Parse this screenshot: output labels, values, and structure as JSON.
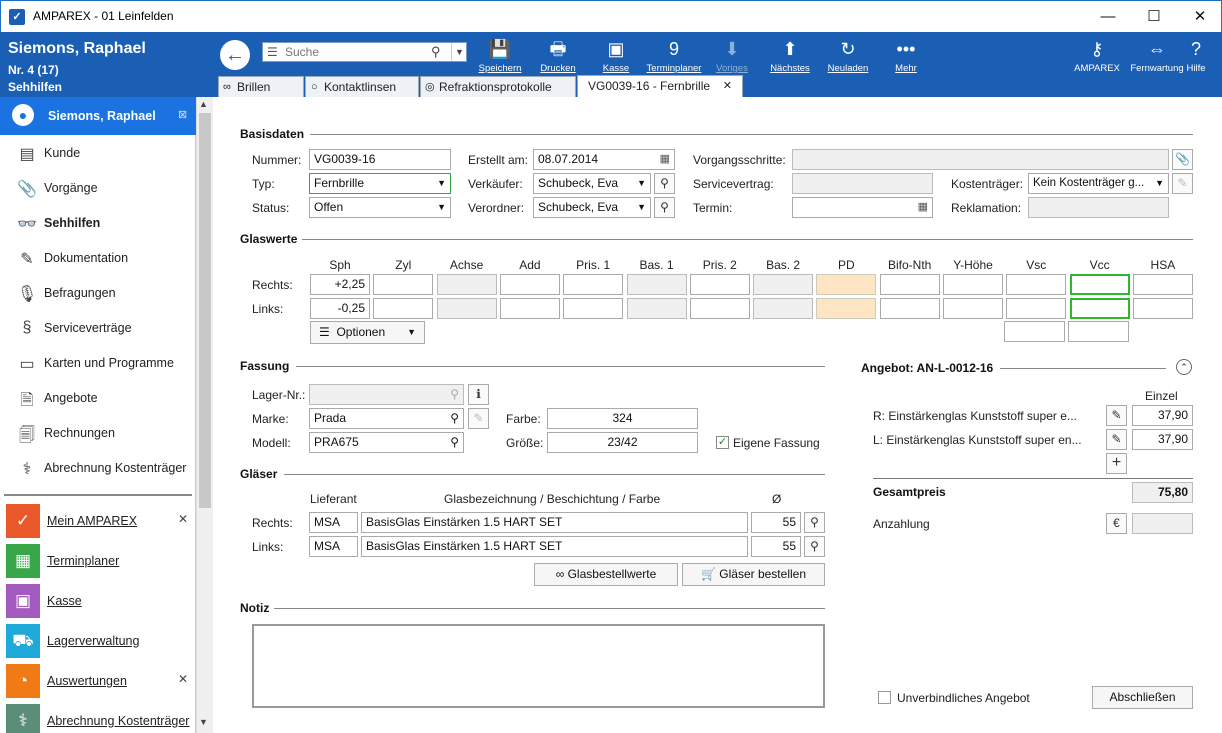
{
  "window": {
    "title": "AMPAREX - 01 Leinfelden",
    "app_icon": "✓"
  },
  "header": {
    "customer_name": "Siemons, Raphael",
    "number": "Nr. 4 (17)",
    "context": "Sehhilfen",
    "search_placeholder": "Suche",
    "toolbar": [
      {
        "label": "Speichern",
        "icon": "save-icon",
        "glyph": "💾",
        "disabled": false
      },
      {
        "label": "Drucken",
        "icon": "printer-icon",
        "glyph": "🖶",
        "disabled": false
      },
      {
        "label": "Kasse",
        "icon": "cash-register-icon",
        "glyph": "▣",
        "disabled": false
      },
      {
        "label": "Terminplaner",
        "icon": "calendar-icon",
        "glyph": "9",
        "disabled": false
      },
      {
        "label": "Voriges",
        "icon": "arrow-down-icon",
        "glyph": "⬇",
        "disabled": true
      },
      {
        "label": "Nächstes",
        "icon": "arrow-up-icon",
        "glyph": "⬆",
        "disabled": false
      },
      {
        "label": "Neuladen",
        "icon": "reload-icon",
        "glyph": "↻",
        "disabled": false
      },
      {
        "label": "Mehr",
        "icon": "more-icon",
        "glyph": "•••",
        "disabled": false
      }
    ],
    "right_toolbar": [
      {
        "label": "AMPAREX",
        "icon": "key-icon",
        "glyph": "⚷"
      },
      {
        "label": "Fernwartung",
        "icon": "remote-icon",
        "glyph": "⇔"
      },
      {
        "label": "Hilfe",
        "icon": "help-icon",
        "glyph": "?"
      }
    ]
  },
  "tabs": [
    {
      "label": "Brillen",
      "icon": "glasses-icon"
    },
    {
      "label": "Kontaktlinsen",
      "icon": "contact-lens-icon"
    },
    {
      "label": "Refraktionsprotokolle",
      "icon": "refraction-icon"
    },
    {
      "label": "VG0039-16 - Fernbrille",
      "icon": "close-icon",
      "active": true
    }
  ],
  "sidebar": {
    "active": "Siemons, Raphael",
    "items": [
      {
        "label": "Kunde",
        "icon": "customer-icon",
        "glyph": "▤"
      },
      {
        "label": "Vorgänge",
        "icon": "paperclip-icon",
        "glyph": "📎"
      },
      {
        "label": "Sehhilfen",
        "icon": "glasses-icon",
        "glyph": "👓",
        "bold": true
      },
      {
        "label": "Dokumentation",
        "icon": "pencil-icon",
        "glyph": "✎"
      },
      {
        "label": "Befragungen",
        "icon": "microphone-icon",
        "glyph": "🎙"
      },
      {
        "label": "Serviceverträge",
        "icon": "paragraph-icon",
        "glyph": "§"
      },
      {
        "label": "Karten und Programme",
        "icon": "cards-icon",
        "glyph": "▭"
      },
      {
        "label": "Angebote",
        "icon": "offer-icon",
        "glyph": "🗎"
      },
      {
        "label": "Rechnungen",
        "icon": "invoice-icon",
        "glyph": "🗐"
      },
      {
        "label": "Abrechnung Kostenträger",
        "icon": "caduceus-icon",
        "glyph": "⚕"
      }
    ],
    "modules": [
      {
        "label": "Mein AMPAREX",
        "icon": "clipboard-icon",
        "glyph": "✓",
        "color": "#e8582b",
        "closable": true
      },
      {
        "label": "Terminplaner",
        "icon": "calendar-icon",
        "glyph": "▦",
        "color": "#3aa64a",
        "closable": false
      },
      {
        "label": "Kasse",
        "icon": "cash-register-icon",
        "glyph": "▣",
        "color": "#a45bbf",
        "closable": false
      },
      {
        "label": "Lagerverwaltung",
        "icon": "inventory-icon",
        "glyph": "⛟",
        "color": "#1fa9d8",
        "closable": false
      },
      {
        "label": "Auswertungen",
        "icon": "pie-chart-icon",
        "glyph": "◔",
        "color": "#f07a16",
        "closable": true
      },
      {
        "label": "Abrechnung Kostenträger",
        "icon": "caduceus-icon",
        "glyph": "⚕",
        "color": "#5c8d78",
        "closable": false
      }
    ]
  },
  "basisdaten": {
    "title": "Basisdaten",
    "nummer_label": "Nummer:",
    "nummer": "VG0039-16",
    "typ_label": "Typ:",
    "typ": "Fernbrille",
    "status_label": "Status:",
    "status": "Offen",
    "erstellt_label": "Erstellt am:",
    "erstellt": "08.07.2014",
    "verkaeufer_label": "Verkäufer:",
    "verkaeufer": "Schubeck, Eva",
    "verordner_label": "Verordner:",
    "verordner": "Schubeck, Eva",
    "vorgangsschritte_label": "Vorgangsschritte:",
    "servicevertrag_label": "Servicevertrag:",
    "termin_label": "Termin:",
    "kostentraeger_label": "Kostenträger:",
    "kostentraeger": "Kein Kostenträger g...",
    "reklamation_label": "Reklamation:"
  },
  "glaswerte": {
    "title": "Glaswerte",
    "columns": [
      "Sph",
      "Zyl",
      "Achse",
      "Add",
      "Pris. 1",
      "Bas. 1",
      "Pris. 2",
      "Bas. 2",
      "PD",
      "Bifo-Nth",
      "Y-Höhe",
      "Vsc",
      "Vcc",
      "HSA"
    ],
    "rechts_label": "Rechts:",
    "links_label": "Links:",
    "rechts_sph": "+2,25",
    "links_sph": "-0,25",
    "optionen": "Optionen"
  },
  "fassung": {
    "title": "Fassung",
    "lager_label": "Lager-Nr.:",
    "marke_label": "Marke:",
    "marke": "Prada",
    "modell_label": "Modell:",
    "modell": "PRA675",
    "farbe_label": "Farbe:",
    "farbe": "324",
    "groesse_label": "Größe:",
    "groesse": "23/42",
    "eigene_label": "Eigene Fassung",
    "eigene_checked": true
  },
  "glaeser": {
    "title": "Gläser",
    "col_lieferant": "Lieferant",
    "col_bezeichnung": "Glasbezeichnung / Beschichtung / Farbe",
    "col_durchmesser": "Ø",
    "rows": [
      {
        "label": "Rechts:",
        "lieferant": "MSA",
        "bezeichnung": "BasisGlas Einstärken 1.5 HART SET",
        "durchmesser": "55"
      },
      {
        "label": "Links:",
        "lieferant": "MSA",
        "bezeichnung": "BasisGlas Einstärken 1.5 HART SET",
        "durchmesser": "55"
      }
    ],
    "glasbestellwerte": "Glasbestellwerte",
    "bestellen": "Gläser bestellen"
  },
  "notiz": {
    "title": "Notiz"
  },
  "angebot": {
    "title": "Angebot: AN-L-0012-16",
    "col_einzel": "Einzel",
    "items": [
      {
        "text": "R: Einstärkenglas Kunststoff super e...",
        "price": "37,90"
      },
      {
        "text": "L: Einstärkenglas Kunststoff super en...",
        "price": "37,90"
      }
    ],
    "gesamt_label": "Gesamtpreis",
    "gesamt": "75,80",
    "anzahlung_label": "Anzahlung",
    "unverbindlich_label": "Unverbindliches Angebot",
    "abschliessen": "Abschließen"
  }
}
